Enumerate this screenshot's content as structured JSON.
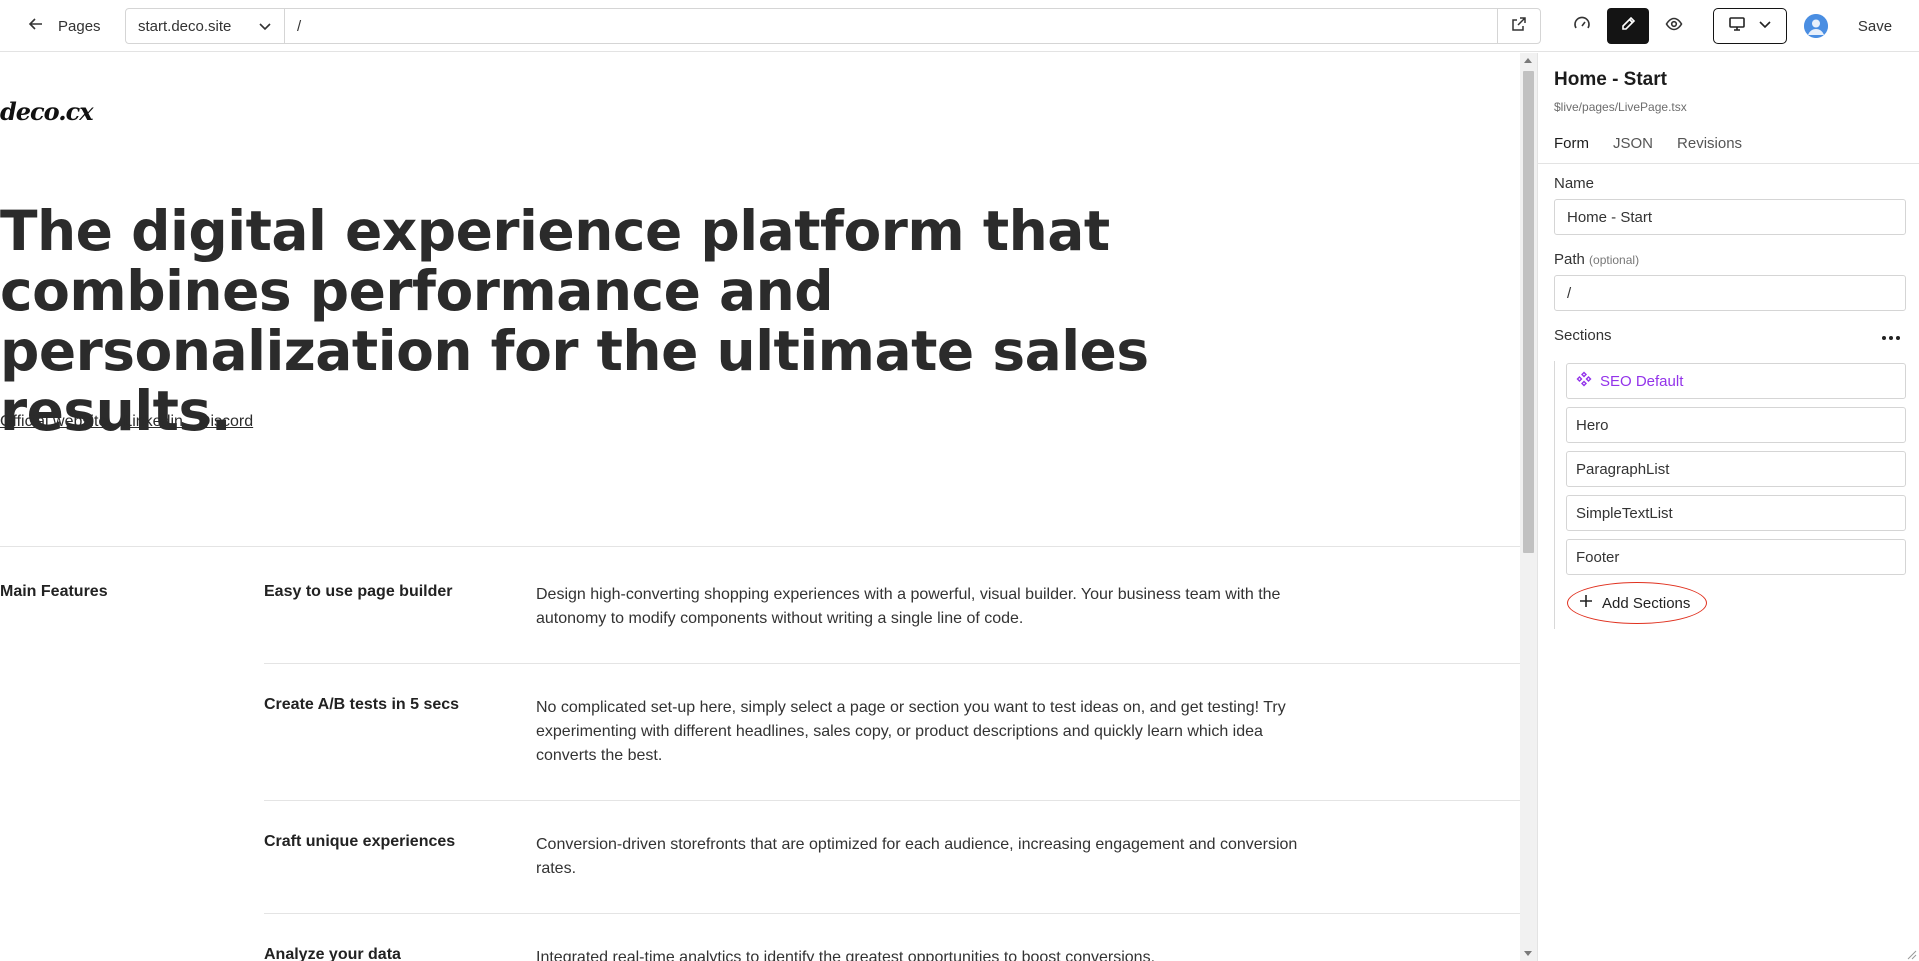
{
  "topbar": {
    "back_label": "Pages",
    "site": "start.deco.site",
    "path": "/",
    "save_label": "Save"
  },
  "preview": {
    "logo": "deco.cx",
    "hero_title": "The digital experience platform that combines performance and personalization for the ultimate sales results.",
    "links": [
      "Official website",
      "Linkedin",
      "Discord"
    ],
    "features_label": "Main Features",
    "features": [
      {
        "title": "Easy to use page builder",
        "desc": "Design high-converting shopping experiences with a powerful, visual builder. Your business team with the autonomy to modify components without writing a single line of code."
      },
      {
        "title": "Create A/B tests in 5 secs",
        "desc": "No complicated set-up here, simply select a page or section you want to test ideas on, and get testing! Try experimenting with different headlines, sales copy, or product descriptions and quickly learn which idea converts the best."
      },
      {
        "title": "Craft unique experiences",
        "desc": "Conversion-driven storefronts that are optimized for each audience, increasing engagement and conversion rates."
      },
      {
        "title": "Analyze your data",
        "desc": "Integrated real-time analytics to identify the greatest opportunities to boost conversions."
      }
    ]
  },
  "panel": {
    "title": "Home - Start",
    "subtitle": "$live/pages/LivePage.tsx",
    "tabs": [
      "Form",
      "JSON",
      "Revisions"
    ],
    "name_label": "Name",
    "name_value": "Home - Start",
    "path_label": "Path",
    "path_optional": "(optional)",
    "path_value": "/",
    "sections_label": "Sections",
    "sections": [
      "SEO Default",
      "Hero",
      "ParagraphList",
      "SimpleTextList",
      "Footer"
    ],
    "add_sections_label": "Add Sections"
  },
  "colors": {
    "accent_purple": "#9333ea",
    "highlight_red": "#e0311f",
    "active_mode": "#141414"
  }
}
